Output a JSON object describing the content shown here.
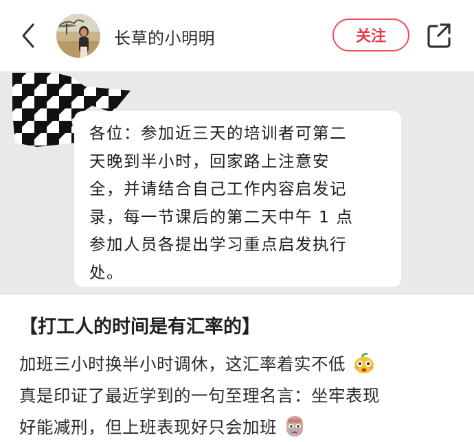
{
  "header": {
    "author_name": "长草的小明明",
    "follow_label": "关注"
  },
  "chat": {
    "message": "各位：参加近三天的培训者可第二\n天晚到半小时，回家路上注意安\n全，并请结合自己工作内容启发记\n录，每一节课后的第二天中午 1 点\n参加人员各提出学习重点启发执行\n处。"
  },
  "post": {
    "title": "【打工人的时间是有汇率的】",
    "line1": "加班三小时换半小时调休，这汇率着实不低",
    "line2": "真是印证了最近学到的一句至理名言：坐牢表现",
    "line3": "好能减刑，但上班表现好只会加班"
  },
  "icons": {
    "back": "back-arrow-icon",
    "share": "share-icon",
    "emoji1": "surprised-pear-emoji-icon",
    "emoji2": "crying-face-emoji-icon"
  },
  "colors": {
    "accent": "#e8394b",
    "chat_bg": "#e9e9eb"
  }
}
